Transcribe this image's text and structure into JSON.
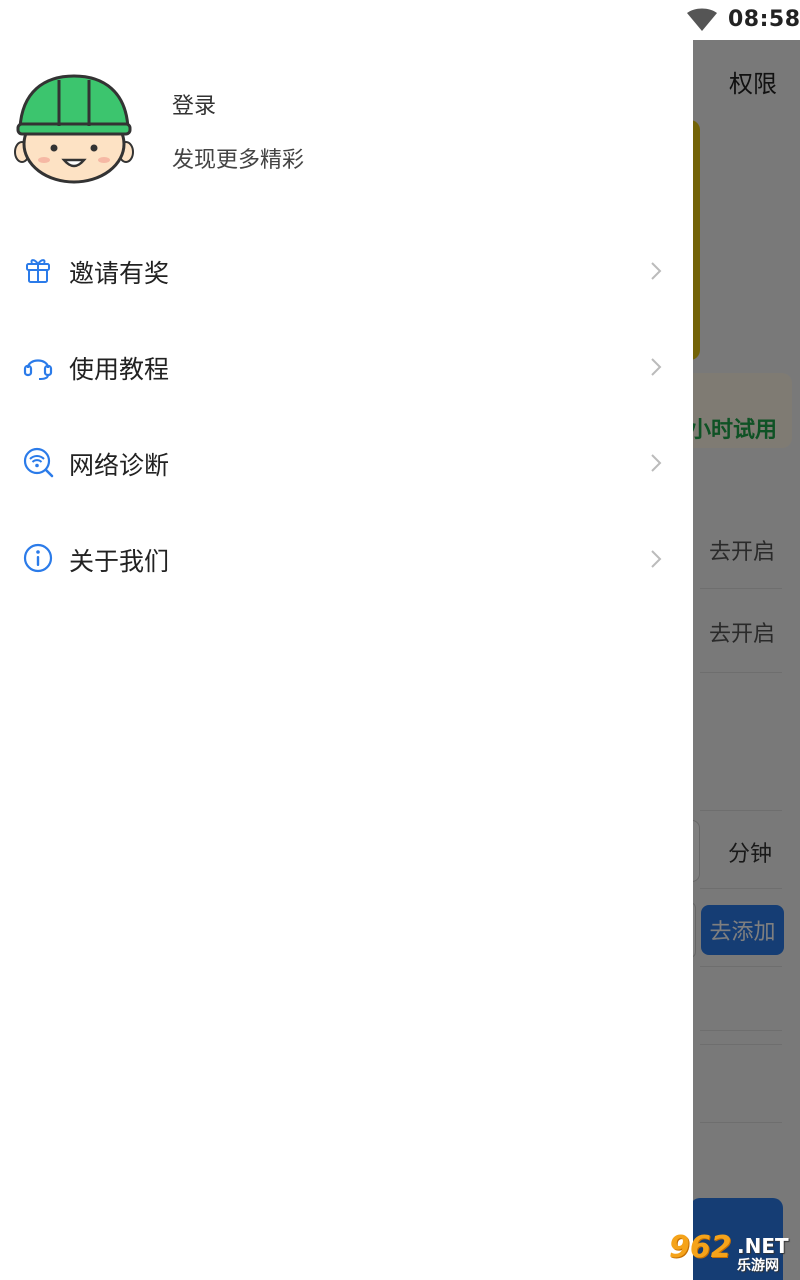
{
  "status_bar": {
    "time": "08:58",
    "wifi_icon": "wifi-icon"
  },
  "background_app": {
    "header_title": "权限",
    "trial_text": "小时试用",
    "open_buttons": [
      "去开启",
      "去开启"
    ],
    "minute_label": "分钟",
    "add_button": "去添加",
    "accent_color": "#2b7be9"
  },
  "drawer": {
    "profile": {
      "login": "登录",
      "subtitle": "发现更多精彩",
      "avatar_icon": "worker-avatar-icon"
    },
    "menu": [
      {
        "label": "邀请有奖",
        "icon": "gift-icon"
      },
      {
        "label": "使用教程",
        "icon": "headset-icon"
      },
      {
        "label": "网络诊断",
        "icon": "wifi-search-icon"
      },
      {
        "label": "关于我们",
        "icon": "info-icon"
      }
    ],
    "icon_color": "#2b7be9"
  },
  "watermark": {
    "number": "962",
    "domain": ".NET",
    "text": "乐游网"
  }
}
